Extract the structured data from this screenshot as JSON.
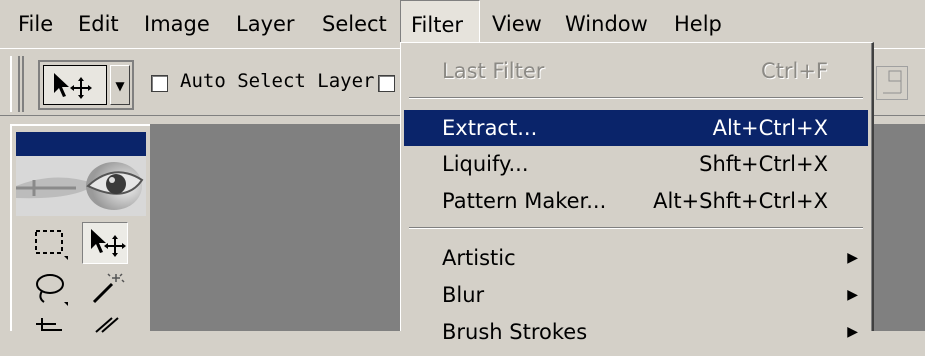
{
  "menubar": {
    "items": [
      {
        "label": "File"
      },
      {
        "label": "Edit"
      },
      {
        "label": "Image"
      },
      {
        "label": "Layer"
      },
      {
        "label": "Select"
      },
      {
        "label": "Filter"
      },
      {
        "label": "View"
      },
      {
        "label": "Window"
      },
      {
        "label": "Help"
      }
    ]
  },
  "options": {
    "auto_select_layer": "Auto Select Layer"
  },
  "filter_menu": {
    "last_filter": {
      "label": "Last Filter",
      "shortcut": "Ctrl+F"
    },
    "extract": {
      "label": "Extract...",
      "shortcut": "Alt+Ctrl+X"
    },
    "liquify": {
      "label": "Liquify...",
      "shortcut": "Shft+Ctrl+X"
    },
    "pattern_maker": {
      "label": "Pattern Maker...",
      "shortcut": "Alt+Shft+Ctrl+X"
    },
    "artistic": {
      "label": "Artistic"
    },
    "blur": {
      "label": "Blur"
    },
    "brush_strokes": {
      "label": "Brush Strokes"
    }
  },
  "colors": {
    "highlight": "#0a246a",
    "menu_bg": "#d4d0c8",
    "canvas_bg": "#808080"
  }
}
